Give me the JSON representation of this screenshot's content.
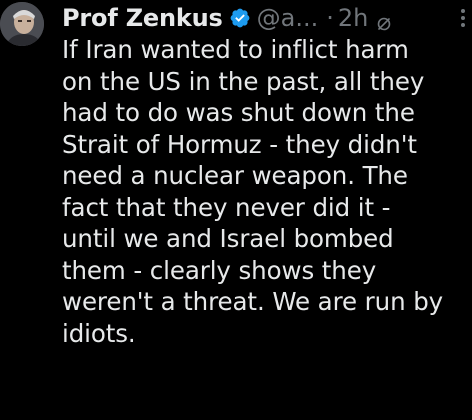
{
  "tweet": {
    "author": {
      "display_name": "Prof Zenkus",
      "handle": "@a...",
      "avatar_icon": "avatar-photo",
      "verified_icon": "verified-badge-icon"
    },
    "separator": "·",
    "timestamp": "2h",
    "grok_icon": "grok-icon",
    "more_icon": "more-vertical-icon",
    "text_lines": [
      "If Iran wanted to inflict harm",
      "on the US in the past, all they",
      "had to do was shut down the",
      "Strait of Hormuz - they didn't",
      "need a nuclear weapon. The",
      "fact that they never did it -",
      "until we and Israel bombed",
      "them - clearly shows they",
      "weren't a threat. We are run by",
      "idiots."
    ]
  },
  "colors": {
    "background": "#000000",
    "text_primary": "#e7e9ea",
    "text_secondary": "#71767b",
    "verified_blue": "#1d9bf0"
  }
}
